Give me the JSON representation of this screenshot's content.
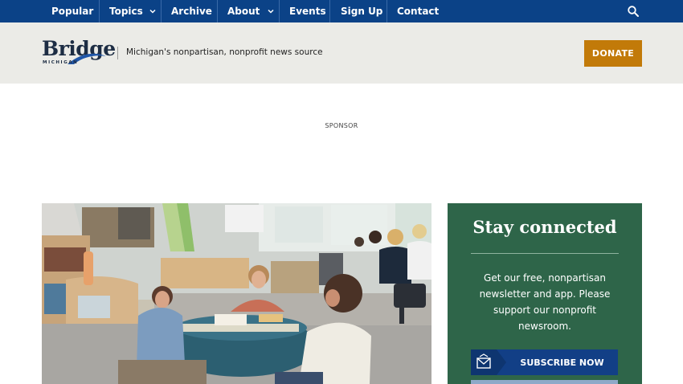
{
  "nav": {
    "items": [
      {
        "label": "Popular",
        "dropdown": false
      },
      {
        "label": "Topics",
        "dropdown": true
      },
      {
        "label": "Archive",
        "dropdown": false
      },
      {
        "label": "About",
        "dropdown": true
      },
      {
        "label": "Events",
        "dropdown": false
      },
      {
        "label": "Sign Up",
        "dropdown": false
      },
      {
        "label": "Contact",
        "dropdown": false
      }
    ],
    "search_icon": "search-icon"
  },
  "masthead": {
    "logo_word": "Bridge",
    "logo_sub": "MICHIGAN",
    "tagline": "Michigan's nonpartisan, nonprofit news source",
    "donate_label": "DONATE"
  },
  "sponsor_label": "SPONSOR",
  "hero": {
    "image": "photo-teachers-classroom-floor"
  },
  "newsletter": {
    "title": "Stay connected",
    "body": "Get our free, nonpartisan newsletter and app. Please support our nonprofit newsroom.",
    "subscribe_label": "SUBSCRIBE NOW",
    "subscribe_icon": "envelope-icon"
  },
  "colors": {
    "nav_bg": "#0b4287",
    "masthead_bg": "#ebebe7",
    "donate_bg": "#c27a09",
    "panel_bg": "#2e6549",
    "subscribe_bg": "#123f86"
  }
}
